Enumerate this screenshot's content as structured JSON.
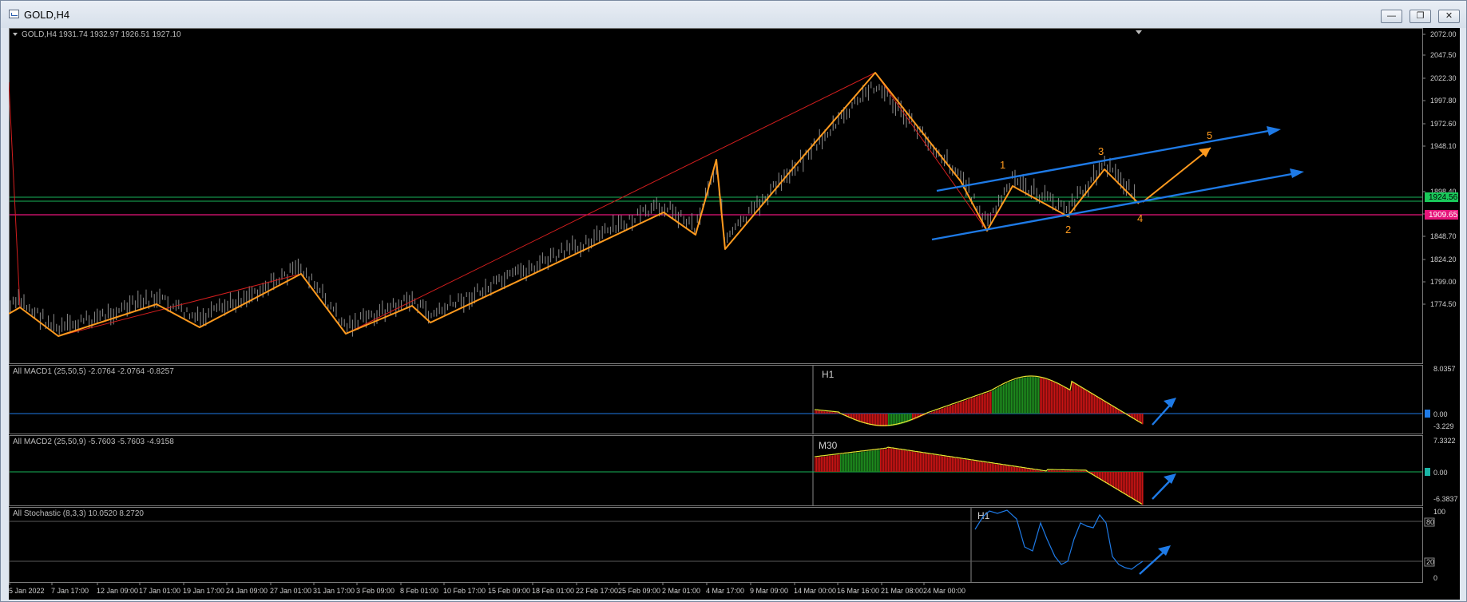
{
  "window": {
    "title": "GOLD,H4",
    "buttons": {
      "minimize": "—",
      "restore": "❐",
      "close": "✕"
    }
  },
  "main_chart": {
    "header": "GOLD,H4  1931.74 1932.97 1926.51 1927.10",
    "price_labels": [
      "2072.00",
      "2047.50",
      "2022.30",
      "1997.80",
      "1972.60",
      "1948.10",
      "1898.40",
      "1873.20",
      "1848.70",
      "1824.20",
      "1799.00",
      "1774.50"
    ],
    "current_price_label": "1924.56",
    "support_price_label": "1909.65",
    "wave_labels": [
      "1",
      "2",
      "3",
      "4",
      "5"
    ],
    "colors": {
      "candles": "#8c8c8c",
      "zigzag": "#ff9a1e",
      "trend_red": "#d21e1e",
      "channel": "#1e7ae6",
      "current_line": "#19b45a",
      "support_line": "#e6147a",
      "current_tag_bg": "#19c85a",
      "support_tag_bg": "#e6147a"
    }
  },
  "macd1": {
    "header": "All MACD1 (25,50,5) -2.0764 -2.0764 -0.8257",
    "tf": "H1",
    "scale": [
      "8.0357",
      "0.00",
      "-3.229"
    ]
  },
  "macd2": {
    "header": "All MACD2 (25,50,9) -5.7603 -5.7603 -4.9158",
    "tf": "M30",
    "scale": [
      "7.3322",
      "0.00",
      "-6.3837"
    ]
  },
  "stoch": {
    "header": "All Stochastic (8,3,3) 10.0520 8.2720",
    "tf": "H1",
    "scale": [
      "100",
      "80",
      "20",
      "0"
    ]
  },
  "time_axis": [
    "5 Jan 2022",
    "7 Jan 17:00",
    "12 Jan 09:00",
    "17 Jan 01:00",
    "19 Jan 17:00",
    "24 Jan 09:00",
    "27 Jan 01:00",
    "31 Jan 17:00",
    "3 Feb 09:00",
    "8 Feb 01:00",
    "10 Feb 17:00",
    "15 Feb 09:00",
    "18 Feb 01:00",
    "22 Feb 17:00",
    "25 Feb 09:00",
    "2 Mar 01:00",
    "4 Mar 17:00",
    "9 Mar 09:00",
    "14 Mar 00:00",
    "16 Mar 16:00",
    "21 Mar 08:00",
    "24 Mar 00:00"
  ]
}
